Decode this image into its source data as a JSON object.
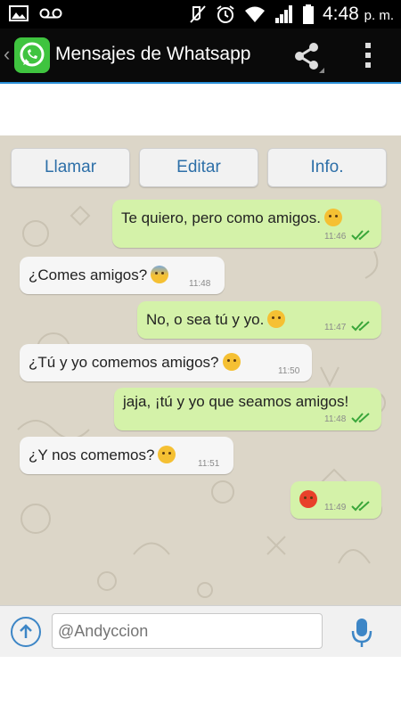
{
  "statusbar": {
    "time": "4:48",
    "ampm": "p. m.",
    "icons": [
      "image-icon",
      "voicemail-icon",
      "mute-icon",
      "alarm-icon",
      "wifi-icon",
      "signal-icon",
      "battery-icon"
    ]
  },
  "actionbar": {
    "title": "Mensajes de Whatsapp",
    "back_icon": "chevron-left-icon",
    "app_icon": "whatsapp-logo",
    "share_icon": "share-icon",
    "menu_icon": "overflow-menu-icon",
    "accent": "#2a90d8"
  },
  "chat": {
    "background": "#dcd6c8",
    "buttons": [
      "Llamar",
      "Editar",
      "Info."
    ],
    "messages": [
      {
        "dir": "out",
        "text": "Te quiero, pero como amigos.",
        "emoji": "smiling-face",
        "time": "11:46"
      },
      {
        "dir": "in",
        "text": "¿Comes amigos?",
        "emoji": "fearful-face",
        "time": "11:48"
      },
      {
        "dir": "out",
        "text": "No, o sea tú y yo.",
        "emoji": "grinning-sweat-face",
        "time": "11:47"
      },
      {
        "dir": "in",
        "text": "¿Tú y yo comemos amigos?",
        "emoji": "disappointed-face",
        "time": "11:50"
      },
      {
        "dir": "out",
        "text": "jaja, ¡tú y yo que seamos amigos!",
        "emoji": "",
        "time": "11:48"
      },
      {
        "dir": "in",
        "text": "¿Y nos comemos?",
        "emoji": "flushed-face",
        "time": "11:51"
      },
      {
        "dir": "out",
        "text": "",
        "emoji": "angry-face",
        "time": "11:49"
      }
    ],
    "outgoing_color": "#d4f2a9",
    "incoming_color": "#f6f6f6",
    "tick_color": "#3aa63a"
  },
  "composer": {
    "placeholder": "@Andyccion",
    "upload_icon": "arrow-up-circle-icon",
    "mic_icon": "microphone-icon"
  }
}
